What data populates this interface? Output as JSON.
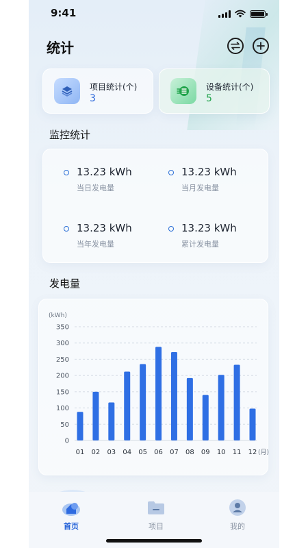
{
  "status_bar": {
    "time": "9:41"
  },
  "header": {
    "title": "统计"
  },
  "summary": {
    "projects": {
      "label": "项目统计(个)",
      "value": "3"
    },
    "devices": {
      "label": "设备统计(个)",
      "value": "5"
    }
  },
  "monitor": {
    "title": "监控统计",
    "items": [
      {
        "value": "13.23 kWh",
        "label": "当日发电量"
      },
      {
        "value": "13.23 kWh",
        "label": "当月发电量"
      },
      {
        "value": "13.23 kWh",
        "label": "当年发电量"
      },
      {
        "value": "13.23 kWh",
        "label": "累计发电量"
      }
    ]
  },
  "generation": {
    "title": "发电量"
  },
  "chart_data": {
    "type": "bar",
    "title": "",
    "ylabel": "(kWh)",
    "xlabel": "(月)",
    "categories": [
      "01",
      "02",
      "03",
      "04",
      "05",
      "06",
      "07",
      "08",
      "09",
      "10",
      "11",
      "12"
    ],
    "values": [
      88,
      150,
      117,
      212,
      235,
      288,
      272,
      192,
      140,
      202,
      233,
      98
    ],
    "yticks": [
      0,
      50,
      100,
      150,
      200,
      250,
      300,
      350
    ],
    "ylim": [
      0,
      350
    ],
    "grid": true,
    "bar_color": "#2f6fe4"
  },
  "tabbar": {
    "items": [
      {
        "label": "首页",
        "active": true
      },
      {
        "label": "项目",
        "active": false
      },
      {
        "label": "我的",
        "active": false
      }
    ]
  },
  "colors": {
    "accent": "#2563d9",
    "success": "#1fa34a"
  }
}
